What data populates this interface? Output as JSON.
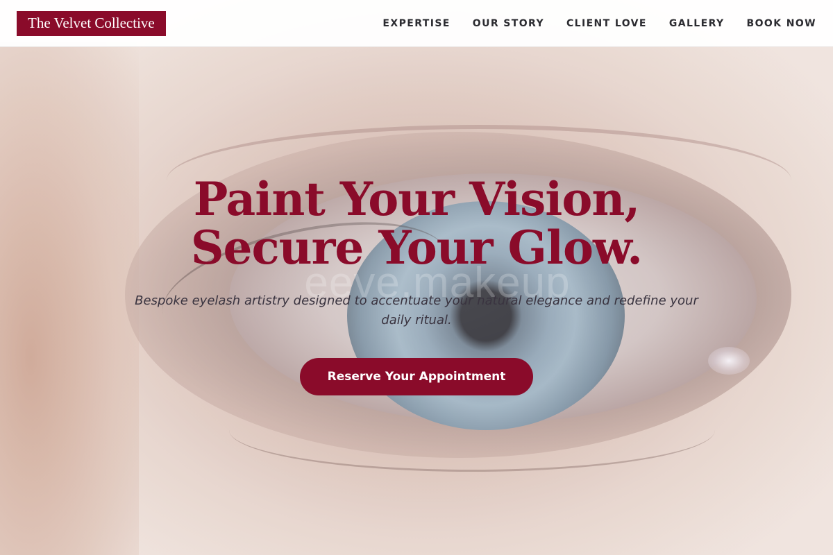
{
  "header": {
    "brand": "The Velvet Collective",
    "nav": [
      {
        "label": "EXPERTISE"
      },
      {
        "label": "OUR STORY"
      },
      {
        "label": "CLIENT LOVE"
      },
      {
        "label": "GALLERY"
      },
      {
        "label": "BOOK NOW"
      }
    ]
  },
  "hero": {
    "headline_line1": "Paint Your Vision,",
    "headline_line2": "Secure Your Glow.",
    "subtitle": "Bespoke eyelash artistry designed to accentuate your natural elegance and redefine your daily ritual.",
    "cta_label": "Reserve Your Appointment",
    "watermark": "eeve.makeup",
    "background_image": "close-up-eye-photo"
  },
  "colors": {
    "accent": "#8a0b2a",
    "nav_text": "#2b2b30",
    "subtitle_text": "#3a3440"
  }
}
